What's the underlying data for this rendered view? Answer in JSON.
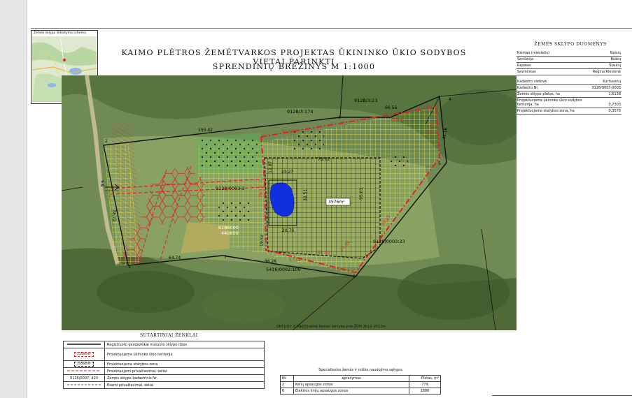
{
  "minimap": {
    "caption": "Žemės sklypo išdėstymo schema"
  },
  "title": {
    "line1": "KAIMO PLĖTROS ŽEMĖTVARKOS PROJEKTAS ŪKININKO ŪKIO SODYBOS VIETAI PARINKTI",
    "line2": "SPRENDINIŲ BRĖŽINYS  M 1:1000"
  },
  "data_panel": {
    "title": "ŽEMĖS SKLYPO DUOMENYS",
    "rows": [
      {
        "label": "Kaimas (miestelis)",
        "value": "Naisių"
      },
      {
        "label": "Seniūnija",
        "value": "Bubių"
      },
      {
        "label": "Rajonas",
        "value": "Šiaulių"
      },
      {
        "label": "Savininkas",
        "value": "Regina Klovienė"
      },
      {
        "label": "Kadastro vietovė",
        "value": "Kurtuvėnų"
      },
      {
        "label": "Kadastro Nr.",
        "value": "9128/0003:0003"
      },
      {
        "label": "Žemės sklypo plotas, ha",
        "value": "1,6138"
      },
      {
        "label": "Projektuojama ūkininko ūkio sodybos teritorija, ha",
        "value": "0,7303"
      },
      {
        "label": "Projektuojama statybos zona, ha",
        "value": "0,3576"
      }
    ]
  },
  "map": {
    "parcel_labels": [
      "9128/3:174",
      "9128/3:23",
      "9128/0003:3",
      "9128/0003:23",
      "5416/0002:109",
      "9116/0007: 423"
    ],
    "point_numbers": [
      "1",
      "2",
      "3",
      "4",
      "5",
      "6",
      "7"
    ],
    "dimensions_black": [
      "155.42",
      "66.56",
      "41.16",
      "64.74",
      "86.26",
      "70.72",
      "32.51",
      "23.27",
      "20.76",
      "12.87",
      "78.72",
      "5.6"
    ],
    "dimensions_red": [
      "51.54",
      "58.53",
      "32.78",
      "57.09",
      "51.40",
      "24.65",
      "79.25",
      "95.01",
      "78.12",
      "19.52"
    ],
    "area_labels": [
      "3576m²"
    ],
    "coordinates": [
      "6186000",
      "440600"
    ],
    "credit": "ORT10LT © Nacionalinė žemės tarnyba prie ŽŪM 2012–2013m."
  },
  "legend": {
    "title": "SUTARTINIAI ŽENKLAI",
    "rows": [
      {
        "symbol": "",
        "text": "Registruoto geodeziškai matuoto sklypo ribos"
      },
      {
        "symbol": "13564m²",
        "text": "Projektuojama ūkininko ūkio teritorija"
      },
      {
        "symbol": "13564m²",
        "text": "Projektuojama statybos zona"
      },
      {
        "symbol": "",
        "text": "Projektuojami privažiavimai, keliai"
      },
      {
        "symbol": "9116/0007: 423",
        "text": "Žemės sklypo kadastrinis Nr."
      },
      {
        "symbol": "",
        "text": "Esami privažiavimai, keliai"
      }
    ]
  },
  "special_conditions": {
    "title": "Specialiosios žemės ir miško naudojimo sąlygos",
    "headers": [
      "Nr.",
      "aprašymas",
      "Plotas, m²"
    ],
    "rows": [
      {
        "nr": "2",
        "desc": "Kelių apsaugos zonos",
        "area": "779"
      },
      {
        "nr": "6",
        "desc": "Elektros linijų apsaugos zonos",
        "area": "1880"
      }
    ]
  },
  "colors": {
    "boundary_red": "#e0202a",
    "parcel_line": "#111111",
    "grid_yellow": "#e8e84a",
    "pond_blue": "#1030e0"
  }
}
